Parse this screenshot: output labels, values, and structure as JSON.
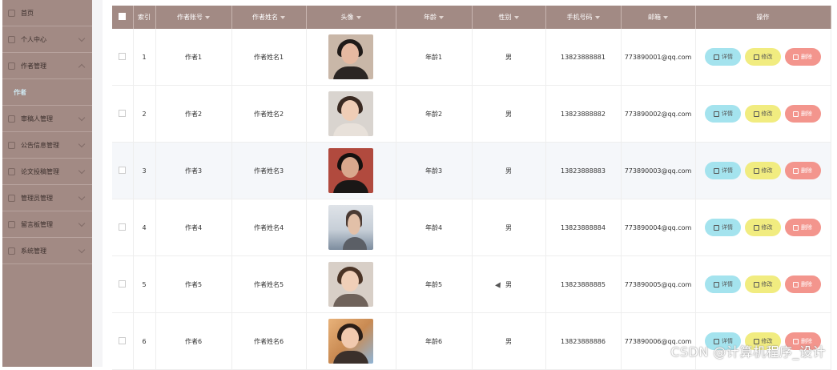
{
  "sidebar": {
    "items": [
      {
        "label": "首页",
        "expandable": false
      },
      {
        "label": "个人中心",
        "expandable": true
      },
      {
        "label": "作者管理",
        "expandable": true
      },
      {
        "label": "作者",
        "sub": true
      },
      {
        "label": "审稿人管理",
        "expandable": true
      },
      {
        "label": "公告信息管理",
        "expandable": true
      },
      {
        "label": "论文投稿管理",
        "expandable": true
      },
      {
        "label": "管理员管理",
        "expandable": true
      },
      {
        "label": "留言板管理",
        "expandable": true
      },
      {
        "label": "系统管理",
        "expandable": true
      }
    ]
  },
  "table": {
    "headers": {
      "index": "索引",
      "account": "作者账号",
      "name": "作者姓名",
      "avatar": "头像",
      "age": "年龄",
      "gender": "性别",
      "phone": "手机号码",
      "email": "邮箱",
      "actions": "操作"
    },
    "rows": [
      {
        "index": "1",
        "account": "作者1",
        "name": "作者姓名1",
        "age": "年龄1",
        "gender": "男",
        "phone": "13823888881",
        "email": "773890001@qq.com"
      },
      {
        "index": "2",
        "account": "作者2",
        "name": "作者姓名2",
        "age": "年龄2",
        "gender": "男",
        "phone": "13823888882",
        "email": "773890002@qq.com"
      },
      {
        "index": "3",
        "account": "作者3",
        "name": "作者姓名3",
        "age": "年龄3",
        "gender": "男",
        "phone": "13823888883",
        "email": "773890003@qq.com"
      },
      {
        "index": "4",
        "account": "作者4",
        "name": "作者姓名4",
        "age": "年龄4",
        "gender": "男",
        "phone": "13823888884",
        "email": "773890004@qq.com"
      },
      {
        "index": "5",
        "account": "作者5",
        "name": "作者姓名5",
        "age": "年龄5",
        "gender": "男",
        "phone": "13823888885",
        "email": "773890005@qq.com"
      },
      {
        "index": "6",
        "account": "作者6",
        "name": "作者姓名6",
        "age": "年龄6",
        "gender": "男",
        "phone": "13823888886",
        "email": "773890006@qq.com"
      }
    ],
    "buttons": {
      "detail": "详情",
      "edit": "修改",
      "delete": "删除"
    }
  },
  "watermark": "CSDN @计算机程序_设计",
  "colors": {
    "sidebar_bg": "#a28a84",
    "header_bg": "#a28a84",
    "detail_btn": "#a4e3ee",
    "edit_btn": "#f1ec80",
    "delete_btn": "#f3958d"
  }
}
